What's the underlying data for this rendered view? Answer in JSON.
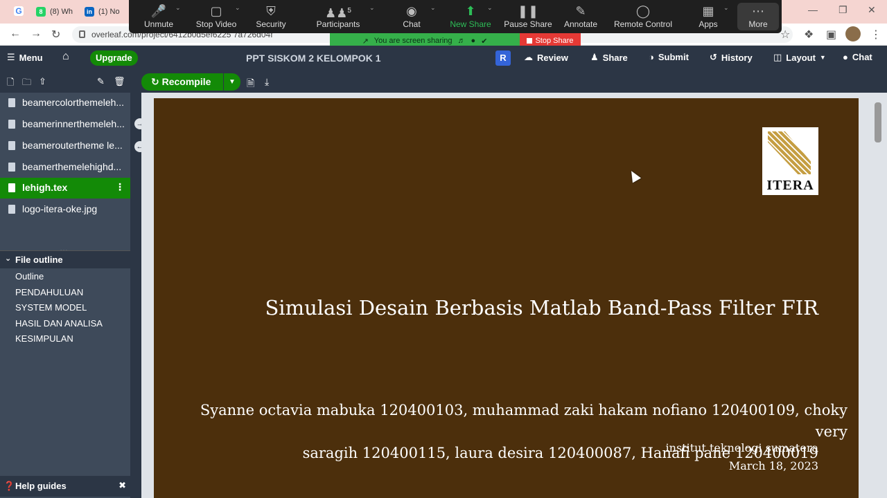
{
  "browser": {
    "tabs": [
      {
        "label": "(8) Wh",
        "icon": "whatsapp-icon",
        "color": "#25d366"
      },
      {
        "label": "(1) No",
        "icon": "linkedin-icon",
        "color": "#0a66c2"
      }
    ],
    "url": "overleaf.com/project/6412b0d5ef6225 7a726d04f"
  },
  "zoom": {
    "items": [
      {
        "label": "Unmute",
        "icon": "microphone-muted-icon"
      },
      {
        "label": "Stop Video",
        "icon": "video-camera-icon"
      },
      {
        "label": "Security",
        "icon": "shield-icon"
      },
      {
        "label": "Participants",
        "icon": "participants-icon",
        "count": "5"
      },
      {
        "label": "Chat",
        "icon": "chat-bubble-icon"
      },
      {
        "label": "New Share",
        "icon": "share-screen-icon"
      },
      {
        "label": "Pause Share",
        "icon": "pause-icon"
      },
      {
        "label": "Annotate",
        "icon": "pencil-icon"
      },
      {
        "label": "Remote Control",
        "icon": "mouse-icon"
      },
      {
        "label": "Apps",
        "icon": "apps-icon"
      },
      {
        "label": "More",
        "icon": "more-dots-icon"
      }
    ],
    "sharing_banner": "You are screen sharing",
    "stop_share": "Stop Share",
    "accent_green": "#2dbd57",
    "stop_red": "#e53935"
  },
  "overleaf": {
    "menu": "Menu",
    "upgrade": "Upgrade",
    "project_title": "PPT SISKOM 2 KELOMPOK 1",
    "avatar_letter": "R",
    "review": "Review",
    "share": "Share",
    "submit": "Submit",
    "history": "History",
    "layout": "Layout",
    "chat": "Chat",
    "brand_green": "#138a07",
    "dark_bg": "#2c3645"
  },
  "files": [
    {
      "name": "beamercolorthemeleh..."
    },
    {
      "name": "beamerinnerthemeleh..."
    },
    {
      "name": "beameroutertheme le..."
    },
    {
      "name": "beamerthemelehighd..."
    },
    {
      "name": "lehigh.tex"
    },
    {
      "name": "logo-itera-oke.jpg"
    }
  ],
  "outline": {
    "heading": "File outline",
    "items": [
      "Outline",
      "PENDAHULUAN",
      "SYSTEM MODEL",
      "HASIL DAN ANALISA",
      "KESIMPULAN"
    ]
  },
  "help": "Help guides",
  "editor": {
    "recompile": "Recompile"
  },
  "slide": {
    "logo_text": "ITERA",
    "title": "Simulasi Desain Berbasis Matlab Band-Pass Filter FIR",
    "authors_line1": "Syanne octavia mabuka 120400103, muhammad zaki hakam nofiano 120400109, choky very",
    "authors_line2": "saragih 120400115, laura desira 120400087, Hanafi pane 120400019",
    "institute": "institut teknologi sumatera",
    "date": "March 18, 2023",
    "background": "#4c2f0c"
  }
}
